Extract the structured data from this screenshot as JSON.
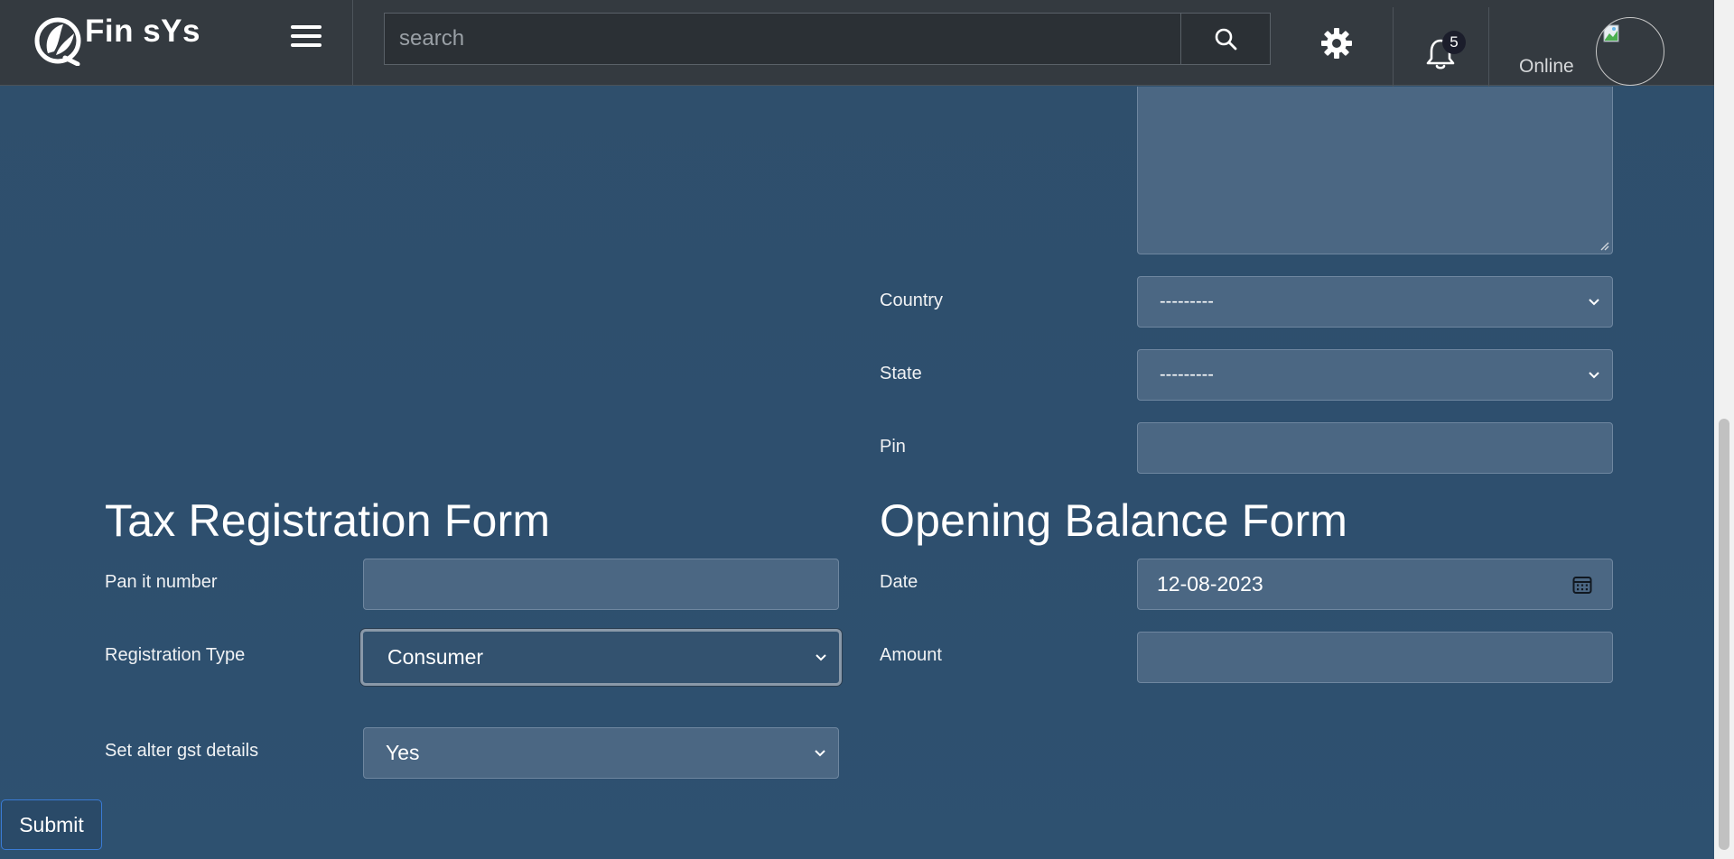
{
  "header": {
    "brand_name": "Fin sYs",
    "search_placeholder": "search",
    "notification_count": "5",
    "status": "Online"
  },
  "address_form": {
    "country_label": "Country",
    "country_value": "---------",
    "state_label": "State",
    "state_value": "---------",
    "pin_label": "Pin",
    "pin_value": ""
  },
  "tax_form": {
    "title": "Tax Registration Form",
    "pan_label": "Pan it number",
    "pan_value": "",
    "registration_type_label": "Registration Type",
    "registration_type_value": "Consumer",
    "gst_label": "Set alter gst details",
    "gst_value": "Yes"
  },
  "opening_balance_form": {
    "title": "Opening Balance Form",
    "date_label": "Date",
    "date_value": "12-08-2023",
    "amount_label": "Amount",
    "amount_value": ""
  },
  "actions": {
    "submit_label": "Submit"
  },
  "icons": {
    "menu": "hamburger-menu-icon",
    "search": "magnifier-icon",
    "settings": "gear-icon",
    "notifications": "bell-icon",
    "calendar": "calendar-icon",
    "select_arrow": "chevron-down-icon"
  },
  "colors": {
    "header_bg": "#343a40",
    "page_bg": "#2e4f6d",
    "field_bg": "#4b6783",
    "submit_border": "#3a7bd5"
  }
}
